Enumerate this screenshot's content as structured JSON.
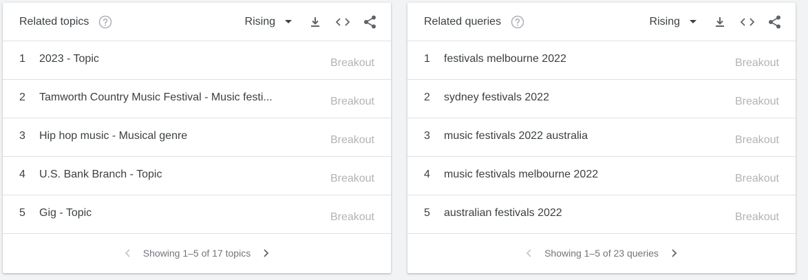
{
  "colors": {
    "text": "#3c4043",
    "muted": "#b3b3b3",
    "icon": "#5f6368",
    "divider": "#e0e0e0"
  },
  "topics": {
    "title": "Related topics",
    "filter": "Rising",
    "rows": [
      {
        "index": "1",
        "label": "2023 - Topic",
        "value": "Breakout"
      },
      {
        "index": "2",
        "label": "Tamworth Country Music Festival - Music festi...",
        "value": "Breakout"
      },
      {
        "index": "3",
        "label": "Hip hop music - Musical genre",
        "value": "Breakout"
      },
      {
        "index": "4",
        "label": "U.S. Bank Branch - Topic",
        "value": "Breakout"
      },
      {
        "index": "5",
        "label": "Gig - Topic",
        "value": "Breakout"
      }
    ],
    "pagination": "Showing 1–5 of 17 topics"
  },
  "queries": {
    "title": "Related queries",
    "filter": "Rising",
    "rows": [
      {
        "index": "1",
        "label": "festivals melbourne 2022",
        "value": "Breakout"
      },
      {
        "index": "2",
        "label": "sydney festivals 2022",
        "value": "Breakout"
      },
      {
        "index": "3",
        "label": "music festivals 2022 australia",
        "value": "Breakout"
      },
      {
        "index": "4",
        "label": "music festivals melbourne 2022",
        "value": "Breakout"
      },
      {
        "index": "5",
        "label": "australian festivals 2022",
        "value": "Breakout"
      }
    ],
    "pagination": "Showing 1–5 of 23 queries"
  },
  "icons": {
    "help": "help-circle-icon",
    "dropdown": "dropdown-arrow-icon",
    "download": "download-icon",
    "embed": "embed-code-icon",
    "share": "share-icon",
    "prev": "chevron-left-icon",
    "next": "chevron-right-icon"
  }
}
